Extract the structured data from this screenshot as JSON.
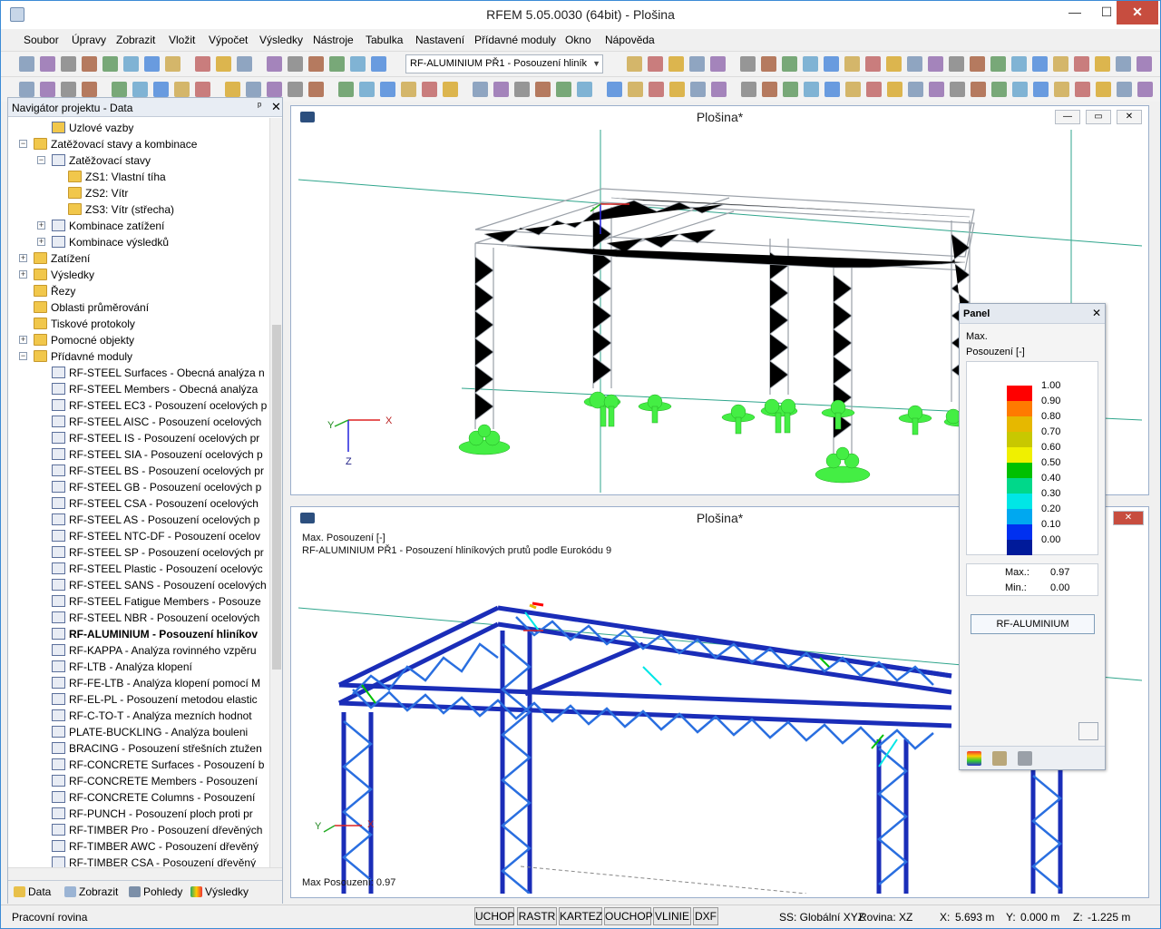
{
  "window": {
    "title": "RFEM 5.05.0030 (64bit) - Plošina",
    "min_label": "—",
    "max_label": "☐",
    "close_label": "✕"
  },
  "menu": [
    "Soubor",
    "Úpravy",
    "Zobrazit",
    "Vložit",
    "Výpočet",
    "Výsledky",
    "Nástroje",
    "Tabulka",
    "Nastavení",
    "Přídavné moduly",
    "Okno",
    "Nápověda"
  ],
  "toolbar": {
    "combo_value": "RF-ALUMINIUM PŘ1 - Posouzení hliník",
    "combo_arrow": "▼"
  },
  "navigator": {
    "title": "Navigátor projektu - Data",
    "pin": "ᵖ",
    "close": "✕",
    "items": [
      {
        "label": "Uzlové vazby",
        "level": 3,
        "icon": "support-icon",
        "bold": false
      },
      {
        "label": "Zatěžovací stavy a kombinace",
        "level": 2,
        "icon": "folder-icon",
        "bold": false,
        "exp": "−"
      },
      {
        "label": "Zatěžovací stavy",
        "level": 3,
        "icon": "load-case-icon",
        "bold": false,
        "exp": "−"
      },
      {
        "label": "ZS1: Vlastní tíha",
        "level": 4,
        "icon": "folder-icon",
        "bold": false
      },
      {
        "label": "ZS2: Vítr",
        "level": 4,
        "icon": "folder-icon",
        "bold": false
      },
      {
        "label": "ZS3: Vítr (střecha)",
        "level": 4,
        "icon": "folder-icon",
        "bold": false
      },
      {
        "label": "Kombinace zatížení",
        "level": 3,
        "icon": "combination-icon",
        "bold": false,
        "exp": "+"
      },
      {
        "label": "Kombinace výsledků",
        "level": 3,
        "icon": "combination-icon",
        "bold": false,
        "exp": "+"
      },
      {
        "label": "Zatížení",
        "level": 2,
        "icon": "folder-icon",
        "bold": false,
        "exp": "+"
      },
      {
        "label": "Výsledky",
        "level": 2,
        "icon": "folder-icon",
        "bold": false,
        "exp": "+"
      },
      {
        "label": "Řezy",
        "level": 2,
        "icon": "folder-icon",
        "bold": false
      },
      {
        "label": "Oblasti průměrování",
        "level": 2,
        "icon": "folder-icon",
        "bold": false
      },
      {
        "label": "Tiskové protokoly",
        "level": 2,
        "icon": "folder-icon",
        "bold": false
      },
      {
        "label": "Pomocné objekty",
        "level": 2,
        "icon": "folder-icon",
        "bold": false,
        "exp": "+"
      },
      {
        "label": "Přídavné moduly",
        "level": 2,
        "icon": "folder-icon",
        "bold": false,
        "exp": "−"
      },
      {
        "label": "RF-STEEL Surfaces - Obecná analýza n",
        "level": 3,
        "icon": "module-icon",
        "bold": false
      },
      {
        "label": "RF-STEEL Members - Obecná analýza",
        "level": 3,
        "icon": "module-icon",
        "bold": false
      },
      {
        "label": "RF-STEEL EC3 - Posouzení ocelových p",
        "level": 3,
        "icon": "module-icon",
        "bold": false
      },
      {
        "label": "RF-STEEL AISC - Posouzení ocelových",
        "level": 3,
        "icon": "module-icon",
        "bold": false
      },
      {
        "label": "RF-STEEL IS - Posouzení ocelových pr",
        "level": 3,
        "icon": "module-icon",
        "bold": false
      },
      {
        "label": "RF-STEEL SIA - Posouzení ocelových p",
        "level": 3,
        "icon": "module-icon",
        "bold": false
      },
      {
        "label": "RF-STEEL BS - Posouzení ocelových pr",
        "level": 3,
        "icon": "module-icon",
        "bold": false
      },
      {
        "label": "RF-STEEL GB - Posouzení ocelových p",
        "level": 3,
        "icon": "module-icon",
        "bold": false
      },
      {
        "label": "RF-STEEL CSA - Posouzení ocelových",
        "level": 3,
        "icon": "module-icon",
        "bold": false
      },
      {
        "label": "RF-STEEL AS - Posouzení ocelových p",
        "level": 3,
        "icon": "module-icon",
        "bold": false
      },
      {
        "label": "RF-STEEL NTC-DF - Posouzení ocelov",
        "level": 3,
        "icon": "module-icon",
        "bold": false
      },
      {
        "label": "RF-STEEL SP - Posouzení ocelových pr",
        "level": 3,
        "icon": "module-icon",
        "bold": false
      },
      {
        "label": "RF-STEEL Plastic - Posouzení ocelovýc",
        "level": 3,
        "icon": "module-icon",
        "bold": false
      },
      {
        "label": "RF-STEEL SANS - Posouzení ocelových",
        "level": 3,
        "icon": "module-icon",
        "bold": false
      },
      {
        "label": "RF-STEEL Fatigue Members - Posouze",
        "level": 3,
        "icon": "module-icon",
        "bold": false
      },
      {
        "label": "RF-STEEL NBR - Posouzení ocelových",
        "level": 3,
        "icon": "module-icon",
        "bold": false
      },
      {
        "label": "RF-ALUMINIUM - Posouzení hliníkov",
        "level": 3,
        "icon": "module-icon",
        "bold": true
      },
      {
        "label": "RF-KAPPA - Analýza rovinného vzpěru",
        "level": 3,
        "icon": "module-icon",
        "bold": false
      },
      {
        "label": "RF-LTB - Analýza klopení",
        "level": 3,
        "icon": "module-icon",
        "bold": false
      },
      {
        "label": "RF-FE-LTB - Analýza klopení pomocí M",
        "level": 3,
        "icon": "module-icon",
        "bold": false
      },
      {
        "label": "RF-EL-PL - Posouzení metodou elastic",
        "level": 3,
        "icon": "module-icon",
        "bold": false
      },
      {
        "label": "RF-C-TO-T - Analýza mezních hodnot",
        "level": 3,
        "icon": "module-icon",
        "bold": false
      },
      {
        "label": "PLATE-BUCKLING - Analýza bouleni",
        "level": 3,
        "icon": "module-icon",
        "bold": false
      },
      {
        "label": "BRACING - Posouzení střešních ztužen",
        "level": 3,
        "icon": "module-icon",
        "bold": false
      },
      {
        "label": "RF-CONCRETE Surfaces - Posouzení b",
        "level": 3,
        "icon": "module-icon",
        "bold": false
      },
      {
        "label": "RF-CONCRETE Members - Posouzení",
        "level": 3,
        "icon": "module-icon",
        "bold": false
      },
      {
        "label": "RF-CONCRETE Columns - Posouzení",
        "level": 3,
        "icon": "module-icon",
        "bold": false
      },
      {
        "label": "RF-PUNCH - Posouzení ploch proti pr",
        "level": 3,
        "icon": "module-icon",
        "bold": false
      },
      {
        "label": "RF-TIMBER Pro - Posouzení dřevěných",
        "level": 3,
        "icon": "module-icon",
        "bold": false
      },
      {
        "label": "RF-TIMBER AWC - Posouzení dřevěný",
        "level": 3,
        "icon": "module-icon",
        "bold": false
      },
      {
        "label": "RF-TIMBER CSA - Posouzení dřevěný",
        "level": 3,
        "icon": "module-icon",
        "bold": false
      }
    ],
    "tabs": [
      {
        "label": "Data",
        "icon": "data-icon"
      },
      {
        "label": "Zobrazit",
        "icon": "display-icon"
      },
      {
        "label": "Pohledy",
        "icon": "views-icon"
      },
      {
        "label": "Výsledky",
        "icon": "results-icon"
      }
    ]
  },
  "view1": {
    "title": "Plošina*",
    "axes": {
      "x": "X",
      "y": "Y",
      "z": "Z"
    }
  },
  "view2": {
    "title": "Plošina*",
    "line1": "Max. Posouzení [-]",
    "line2": "RF-ALUMINIUM PŘ1 - Posouzení hliníkových prutů podle Eurokódu 9",
    "footer": "Max Posouzení: 0.97",
    "axes": {
      "x": "X",
      "y": "Y"
    }
  },
  "panel": {
    "title": "Panel",
    "close": "✕",
    "max_label": "Max.",
    "quantity": "Posouzení [-]",
    "legend": [
      {
        "value": "1.00",
        "color": "#ff0000"
      },
      {
        "value": "0.90",
        "color": "#ff7a00"
      },
      {
        "value": "0.80",
        "color": "#e6b800"
      },
      {
        "value": "0.70",
        "color": "#c8c800"
      },
      {
        "value": "0.60",
        "color": "#f0f000"
      },
      {
        "value": "0.50",
        "color": "#00c000"
      },
      {
        "value": "0.40",
        "color": "#00d88a"
      },
      {
        "value": "0.30",
        "color": "#00e6e6"
      },
      {
        "value": "0.20",
        "color": "#00a8f0"
      },
      {
        "value": "0.10",
        "color": "#0030f0"
      },
      {
        "value": "0.00",
        "color": "#001a9a"
      }
    ],
    "max_text": "Max.:",
    "max_value": "0.97",
    "min_text": "Min.:",
    "min_value": "0.00",
    "button": "RF-ALUMINIUM"
  },
  "statusbar": {
    "text": "Pracovní rovina",
    "buttons": [
      "UCHOP",
      "RASTR",
      "KARTEZ",
      "OUCHOP",
      "VLINIE",
      "DXF"
    ],
    "ss": "SS: Globální XYZ",
    "plane": "Rovina: XZ",
    "x_label": "X:",
    "x_value": "5.693 m",
    "y_label": "Y:",
    "y_value": "0.000 m",
    "z_label": "Z:",
    "z_value": "-1.225 m"
  }
}
